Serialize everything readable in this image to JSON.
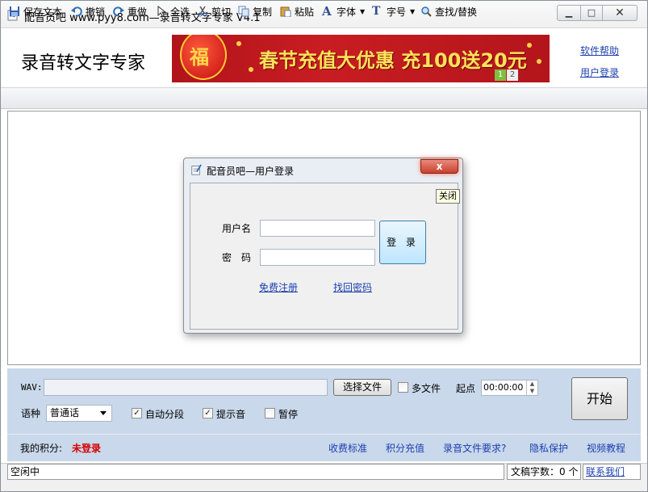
{
  "window": {
    "title": "配音员吧 www.pyy8.com—录音转文字专家 V4.1",
    "min_icon": "minimize-icon",
    "max_icon": "maximize-icon",
    "close_icon": "close-icon"
  },
  "header": {
    "app_heading": "录音转文字专家",
    "banner_text": "春节充值大优惠 充100送20元",
    "banner_fu": "福",
    "banner_pages": [
      "1",
      "2"
    ],
    "links": {
      "help": "软件帮助",
      "login": "用户登录"
    }
  },
  "toolbar": {
    "items": [
      {
        "label": "保存文本",
        "icon": "save-icon"
      },
      {
        "label": "撤销",
        "icon": "undo-icon"
      },
      {
        "label": "重做",
        "icon": "redo-icon"
      },
      {
        "label": "全选",
        "icon": "select-all-icon"
      },
      {
        "label": "剪切",
        "icon": "cut-icon"
      },
      {
        "label": "复制",
        "icon": "copy-icon"
      },
      {
        "label": "粘贴",
        "icon": "paste-icon"
      },
      {
        "label": "字体",
        "icon": "font-icon"
      },
      {
        "label": "字号",
        "icon": "font-size-icon"
      },
      {
        "label": "查找/替换",
        "icon": "find-replace-icon"
      }
    ]
  },
  "dialog": {
    "title": "配音员吧—用户登录",
    "close_label": "x",
    "tooltip": "关闭",
    "username_label": "用户名",
    "password_label": "密　码",
    "username_value": "",
    "password_value": "",
    "login_button": "登 录",
    "register_link": "免费注册",
    "recover_link": "找回密码"
  },
  "controls": {
    "wav_label": "WAV:",
    "wav_value": "",
    "choose_file": "选择文件",
    "multi_file": "多文件",
    "multi_file_checked": false,
    "start_point_label": "起点",
    "start_time": "00:00:00",
    "start_button": "开始",
    "language_label": "语种",
    "language_value": "普通话",
    "auto_segment": "自动分段",
    "auto_segment_checked": true,
    "beep": "提示音",
    "beep_checked": true,
    "pause": "暂停",
    "pause_checked": false
  },
  "footer": {
    "points_label": "我的积分:",
    "points_value": "未登录",
    "links": [
      "收费标准",
      "积分充值",
      "录音文件要求?",
      "隐私保护",
      "视频教程"
    ]
  },
  "status": {
    "state": "空闲中",
    "char_count": "文稿字数：0 个",
    "contact": "联系我们"
  },
  "colors": {
    "link": "#1c3fb0",
    "points_value": "#d40000",
    "banner_bg": "#c81d22",
    "panel_bg": "#c9d8ea"
  }
}
